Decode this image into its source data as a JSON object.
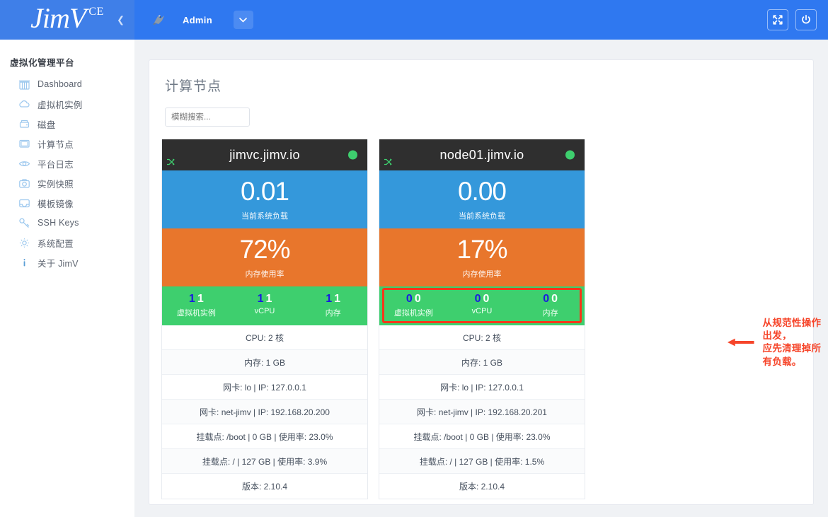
{
  "header": {
    "logo": "JimV",
    "logo_edition": "CE",
    "collapse_icon": "chevron-left-icon",
    "avatar_icon": "bird-avatar-icon",
    "user_name": "Admin",
    "dropdown_icon": "chevron-down-icon",
    "fullscreen_icon": "fullscreen-icon",
    "power_icon": "power-icon"
  },
  "sidebar": {
    "title": "虚拟化管理平台",
    "items": [
      {
        "label": "Dashboard",
        "icon": "dashboard-icon"
      },
      {
        "label": "虚拟机实例",
        "icon": "cloud-icon"
      },
      {
        "label": "磁盘",
        "icon": "disk-icon"
      },
      {
        "label": "计算节点",
        "icon": "monitor-icon"
      },
      {
        "label": "平台日志",
        "icon": "eye-icon"
      },
      {
        "label": "实例快照",
        "icon": "camera-icon"
      },
      {
        "label": "模板镜像",
        "icon": "image-icon"
      },
      {
        "label": "SSH Keys",
        "icon": "key-icon"
      },
      {
        "label": "系统配置",
        "icon": "gear-icon"
      },
      {
        "label": "关于 JimV",
        "icon": "info-icon"
      }
    ]
  },
  "main": {
    "page_title": "计算节点",
    "search_placeholder": "模糊搜索...",
    "nodes": [
      {
        "name": "jimvc.jimv.io",
        "status": "online",
        "status_color": "#3ecf6e",
        "shuffle_icon": "shuffle-icon",
        "load_value": "0.01",
        "load_caption": "当前系统负载",
        "memory_value": "72%",
        "memory_caption": "内存使用率",
        "highlight": false,
        "resources": [
          {
            "used": "1",
            "total": "1",
            "caption": "虚拟机实例"
          },
          {
            "used": "1",
            "total": "1",
            "caption": "vCPU"
          },
          {
            "used": "1",
            "total": "1",
            "caption": "内存"
          }
        ],
        "details": [
          "CPU: 2 核",
          "内存: 1 GB",
          "网卡: lo | IP: 127.0.0.1",
          "网卡: net-jimv | IP: 192.168.20.200",
          "挂载点: /boot | 0 GB | 使用率: 23.0%",
          "挂载点: / | 127 GB | 使用率: 3.9%",
          "版本: 2.10.4"
        ]
      },
      {
        "name": "node01.jimv.io",
        "status": "online",
        "status_color": "#3ecf6e",
        "shuffle_icon": "shuffle-icon",
        "load_value": "0.00",
        "load_caption": "当前系统负载",
        "memory_value": "17%",
        "memory_caption": "内存使用率",
        "highlight": true,
        "resources": [
          {
            "used": "0",
            "total": "0",
            "caption": "虚拟机实例"
          },
          {
            "used": "0",
            "total": "0",
            "caption": "vCPU"
          },
          {
            "used": "0",
            "total": "0",
            "caption": "内存"
          }
        ],
        "details": [
          "CPU: 2 核",
          "内存: 1 GB",
          "网卡: lo | IP: 127.0.0.1",
          "网卡: net-jimv | IP: 192.168.20.201",
          "挂载点: /boot | 0 GB | 使用率: 23.0%",
          "挂载点: / | 127 GB | 使用率: 1.5%",
          "版本: 2.10.4"
        ]
      }
    ]
  },
  "annotation": {
    "arrow_icon": "left-arrow-icon",
    "text": "从规范性操作出发，\n应先清理掉所有负载。",
    "color": "#f6452a"
  },
  "colors": {
    "brand_blue": "#2f78f0",
    "load_blue": "#3498db",
    "memory_orange": "#e8762c",
    "resource_green": "#3ecf6e",
    "highlight_red": "#f6361a",
    "card_header_dark": "#2f2f2f"
  }
}
